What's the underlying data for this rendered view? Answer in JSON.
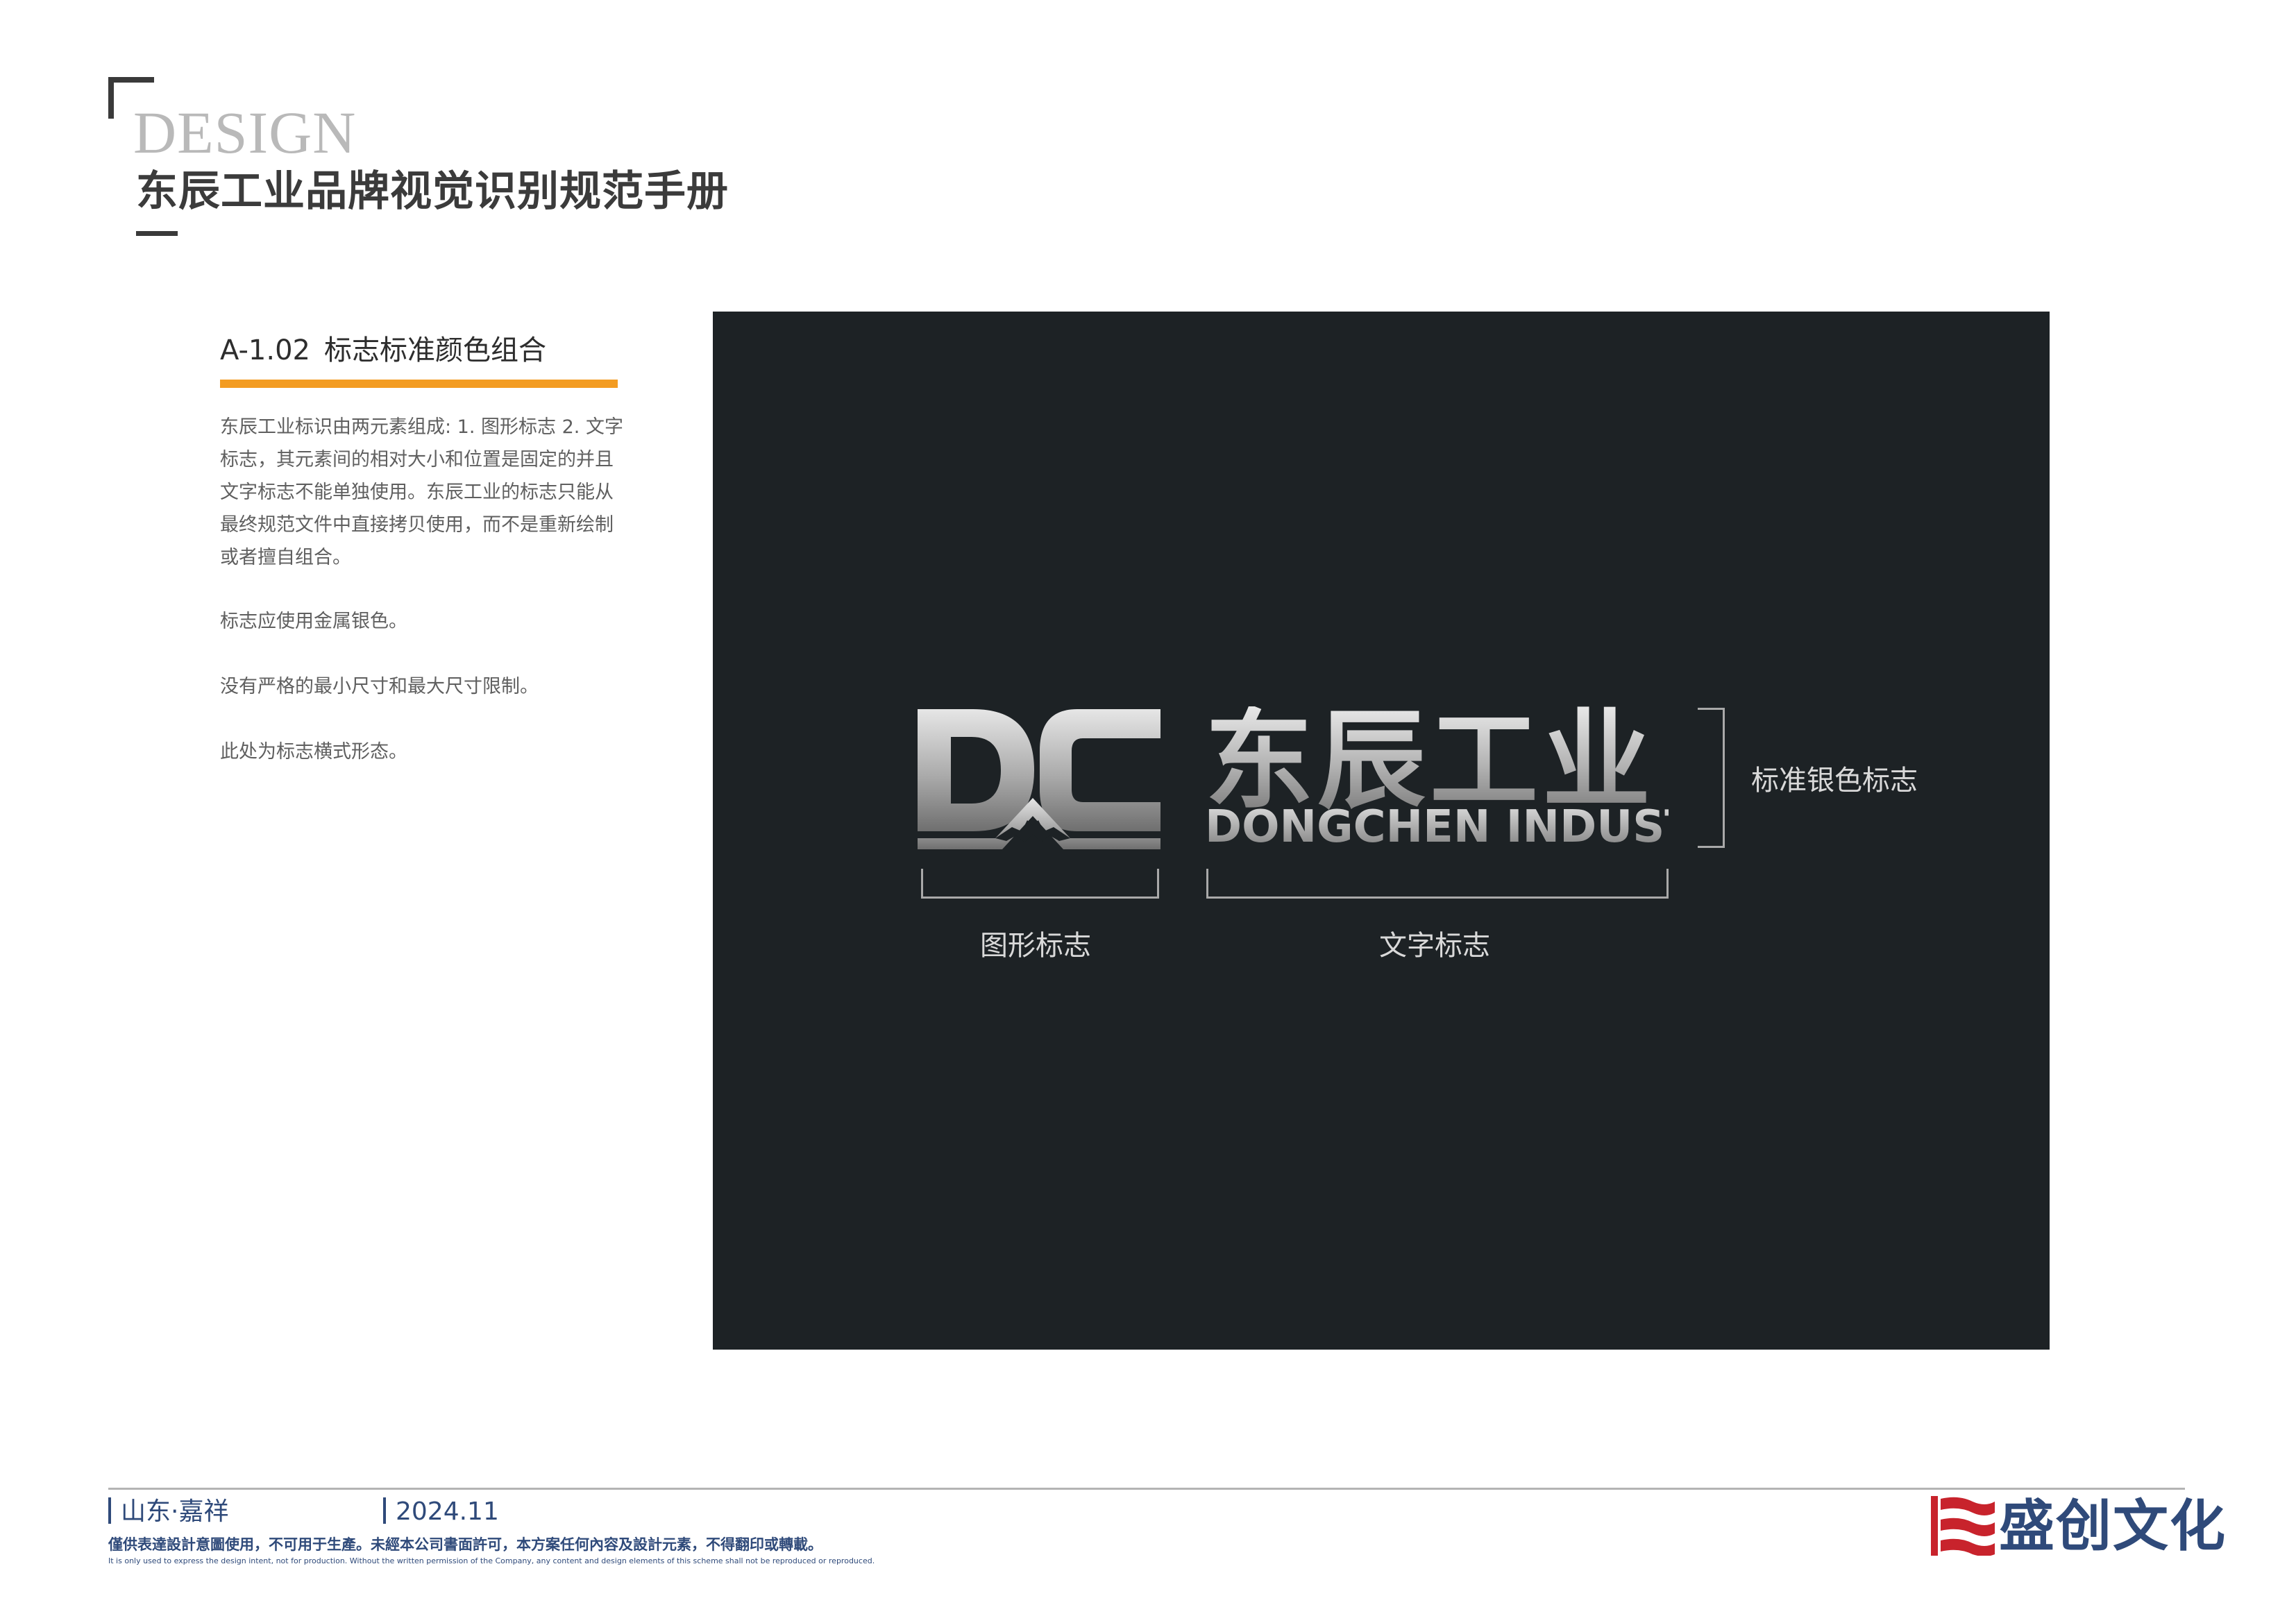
{
  "header": {
    "design_word": "DESIGN",
    "manual_title": "东辰工业品牌视觉识别规范手册"
  },
  "section": {
    "code": "A-1.02",
    "title": "标志标准颜色组合",
    "accent_color": "#f39c22",
    "paragraphs": [
      "东辰工业标识由两元素组成: 1. 图形标志 2. 文字标志，其元素间的相对大小和位置是固定的并且文字标志不能单独使用。东辰工业的标志只能从最终规范文件中直接拷贝使用，而不是重新绘制或者擅自组合。",
      "标志应使用金属银色。",
      "没有严格的最小尺寸和最大尺寸限制。",
      "此处为标志横式形态。"
    ]
  },
  "logo": {
    "panel_color": "#1d2225",
    "name_cn": "东辰工业",
    "name_en": "DONGCHEN INDUSTRY",
    "label_graphic": "图形标志",
    "label_text": "文字标志",
    "label_standard": "标准银色标志"
  },
  "footer": {
    "location": "山东·嘉祥",
    "date": "2024.11",
    "disclaimer_cn": "僅供表達設計意圖使用，不可用于生產。未經本公司書面許可，本方案任何內容及設計元素，不得翻印或轉載。",
    "disclaimer_en": "It is only used to express the design intent, not for production. Without the written permission of the Company, any content and design elements of this scheme shall not be reproduced or reproduced.",
    "company_name": "盛创文化",
    "brand_color": "#2f4a7a",
    "mark_color": "#c8232c"
  }
}
